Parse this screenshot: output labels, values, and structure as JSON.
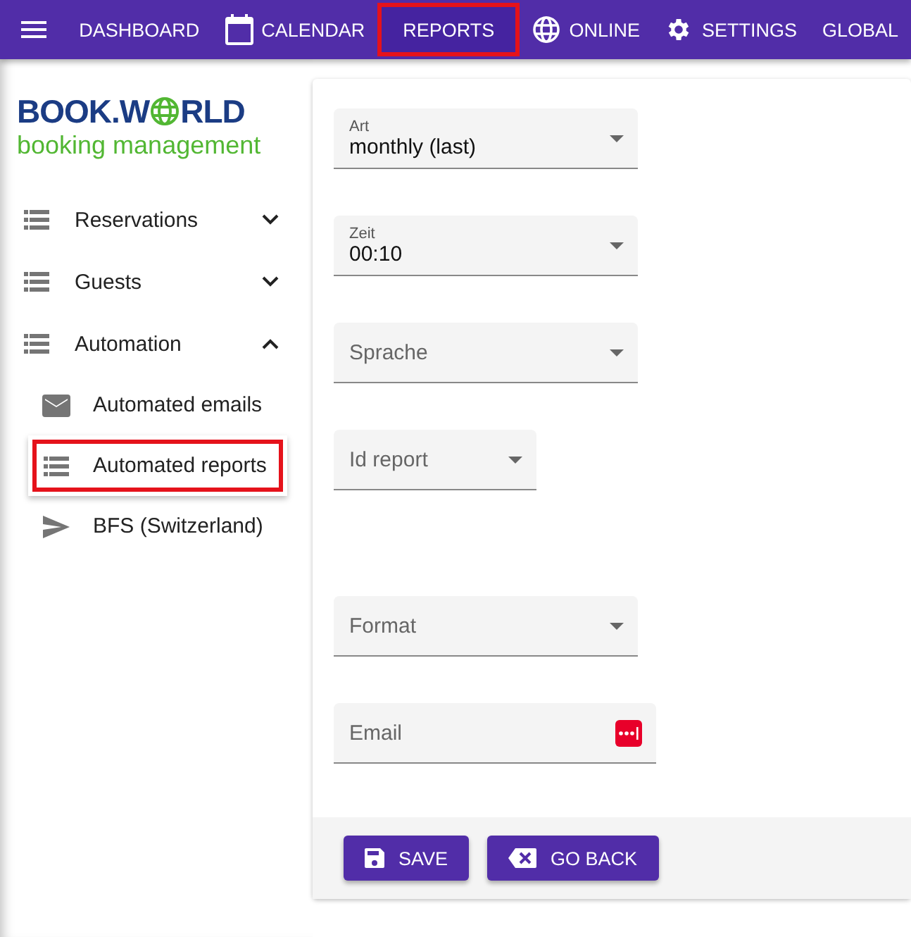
{
  "topbar": {
    "nav": [
      {
        "label": "DASHBOARD",
        "kind": "plain",
        "highlighted": false
      },
      {
        "label": "CALENDAR",
        "kind": "calendar",
        "highlighted": false
      },
      {
        "label": "REPORTS",
        "kind": "plain",
        "highlighted": true
      },
      {
        "label": "ONLINE",
        "kind": "globe",
        "highlighted": false
      },
      {
        "label": "SETTINGS",
        "kind": "gear",
        "highlighted": false
      },
      {
        "label": "GLOBAL",
        "kind": "plain",
        "highlighted": false
      }
    ]
  },
  "logo": {
    "left": "BOOK.W",
    "right": "RLD",
    "tagline": "booking management"
  },
  "sidebar": {
    "items": [
      {
        "label": "Reservations",
        "kind": "list",
        "expanded": false
      },
      {
        "label": "Guests",
        "kind": "list",
        "expanded": false
      },
      {
        "label": "Automation",
        "kind": "list",
        "expanded": true,
        "children": [
          {
            "label": "Automated emails",
            "kind": "mail",
            "highlighted": false
          },
          {
            "label": "Automated reports",
            "kind": "list",
            "highlighted": true
          },
          {
            "label": "BFS (Switzerland)",
            "kind": "send",
            "highlighted": false
          }
        ]
      }
    ]
  },
  "form": {
    "fields": [
      {
        "kind": "select",
        "label": "Art",
        "value": "monthly (last)"
      },
      {
        "kind": "select",
        "label": "Zeit",
        "value": "00:10"
      },
      {
        "kind": "select",
        "placeholder": "Sprache"
      },
      {
        "kind": "select",
        "placeholder": "Id report"
      },
      {
        "kind": "select",
        "placeholder": "Format"
      },
      {
        "kind": "text",
        "placeholder": "Email"
      }
    ],
    "buttons": [
      {
        "label": "SAVE",
        "kind": "save"
      },
      {
        "label": "GO BACK",
        "kind": "back"
      }
    ]
  }
}
